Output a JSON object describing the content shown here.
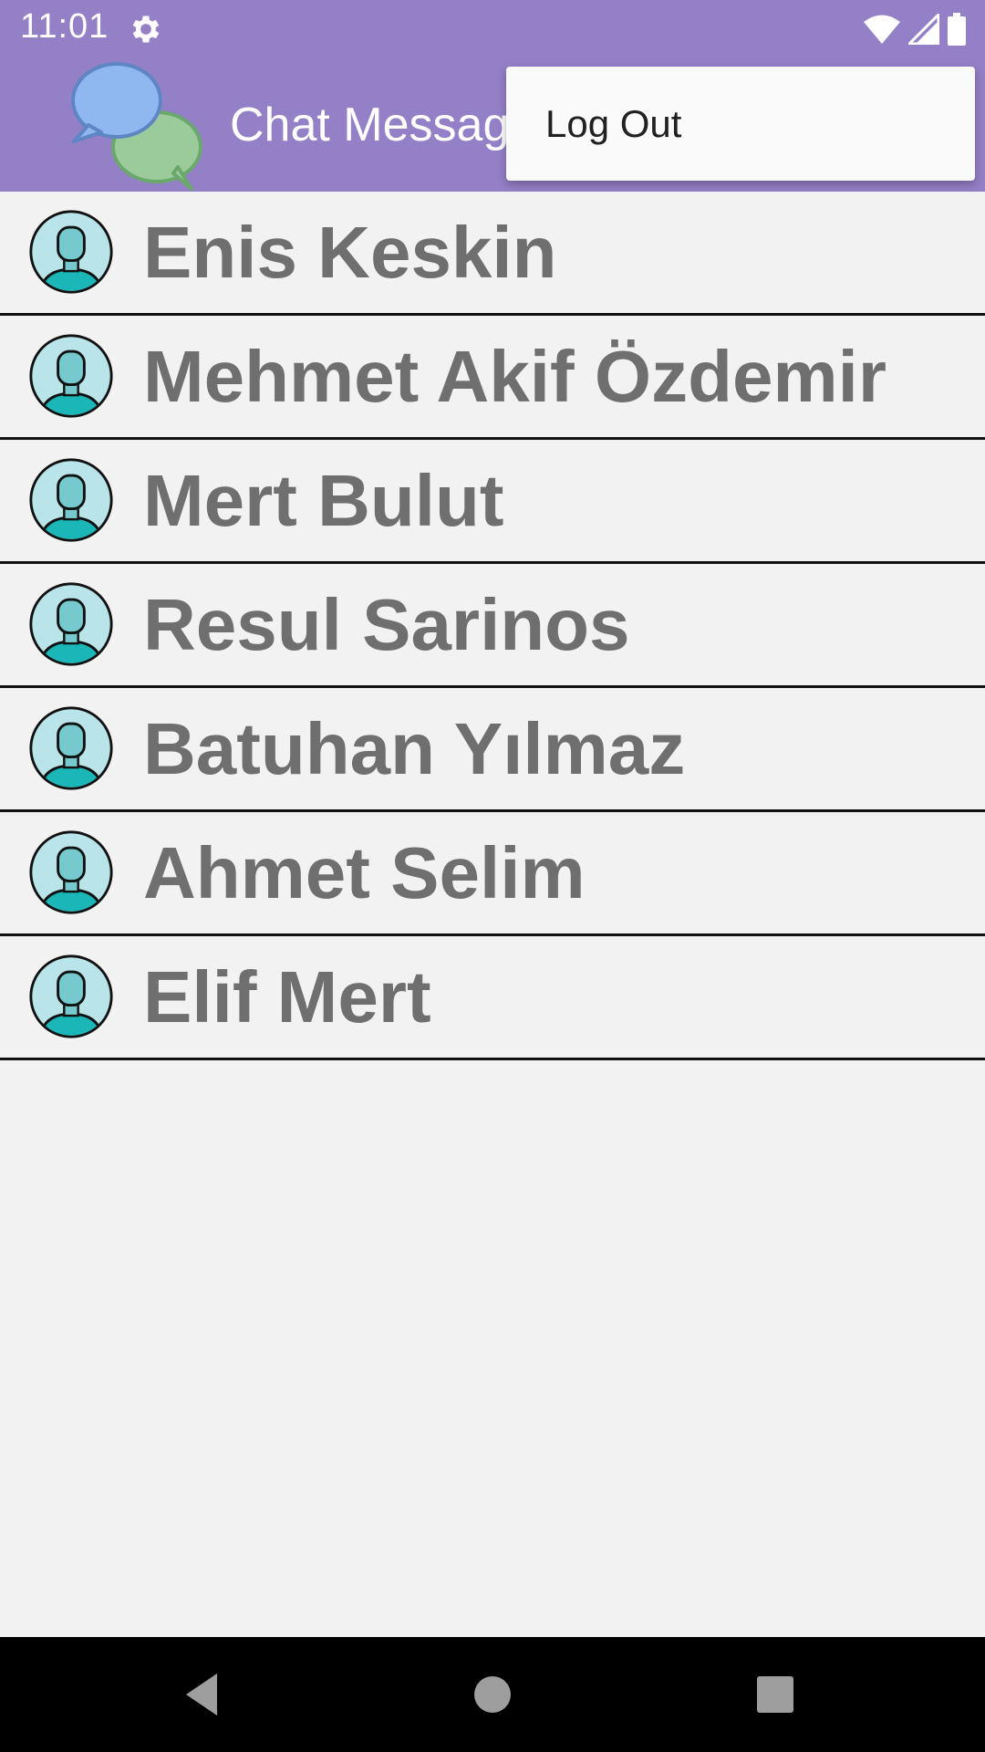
{
  "status_bar": {
    "time": "11:01",
    "icons": [
      "gear-icon",
      "wifi-icon",
      "cellular-signal-icon",
      "battery-icon"
    ]
  },
  "app_bar": {
    "title": "Chat Messag",
    "logo_icon": "chat-bubbles-icon",
    "colors": {
      "primary": "#9480c7"
    }
  },
  "popup_menu": {
    "items": [
      {
        "label": "Log Out"
      }
    ]
  },
  "contacts": [
    {
      "name": "Enis Keskin",
      "icon": "user-avatar-icon"
    },
    {
      "name": "Mehmet Akif Özdemir",
      "icon": "user-avatar-icon"
    },
    {
      "name": "Mert Bulut",
      "icon": "user-avatar-icon"
    },
    {
      "name": "Resul Sarinos",
      "icon": "user-avatar-icon"
    },
    {
      "name": "Batuhan Yılmaz",
      "icon": "user-avatar-icon"
    },
    {
      "name": "Ahmet Selim",
      "icon": "user-avatar-icon"
    },
    {
      "name": "Elif Mert",
      "icon": "user-avatar-icon"
    }
  ],
  "nav_bar": {
    "buttons": [
      "back-icon",
      "home-icon",
      "recents-icon"
    ]
  }
}
